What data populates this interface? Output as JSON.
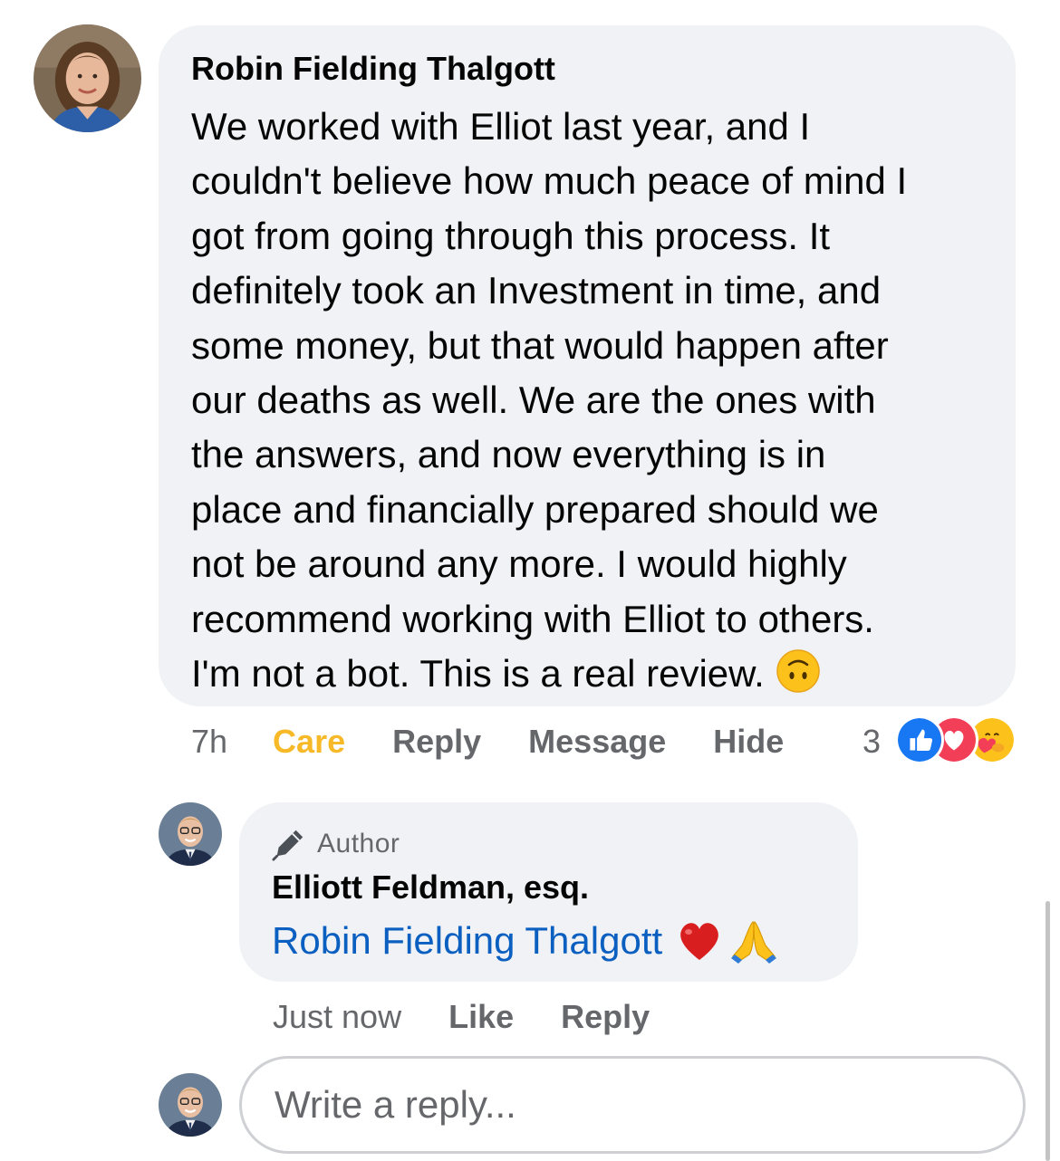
{
  "comment": {
    "author": "Robin Fielding Thalgott",
    "lines": [
      "We worked with Elliot last year, and I",
      "couldn't believe how much peace of mind I",
      "got from going through this process. It",
      "definitely took an Investment in time, and",
      "some money, but that would happen after",
      "our deaths as well. We are the ones with",
      "the answers, and now everything is in",
      "place and financially prepared should we",
      "not be around any more. I would highly",
      "recommend working with Elliot to others.",
      "I'm not a bot. This is a real review."
    ],
    "trailing_emoji": "upside-down-face-icon",
    "time": "7h",
    "actions": {
      "care": "Care",
      "reply": "Reply",
      "message": "Message",
      "hide": "Hide"
    },
    "reaction_count": "3",
    "reactions": [
      "like-icon",
      "love-icon",
      "care-icon"
    ]
  },
  "reply": {
    "badge": "Author",
    "author": "Elliott Feldman, esq.",
    "mention": "Robin Fielding Thalgott",
    "emojis": [
      "red-heart-icon",
      "folded-hands-icon"
    ],
    "time": "Just now",
    "actions": {
      "like": "Like",
      "reply": "Reply"
    }
  },
  "composer": {
    "placeholder": "Write a reply..."
  },
  "colors": {
    "bubble": "#f0f2f5",
    "secondary_text": "#65676b",
    "care": "#f7b928",
    "mention_link": "#0a5fc0",
    "like_blue": "#1877f2",
    "love_red": "#f33e58"
  }
}
